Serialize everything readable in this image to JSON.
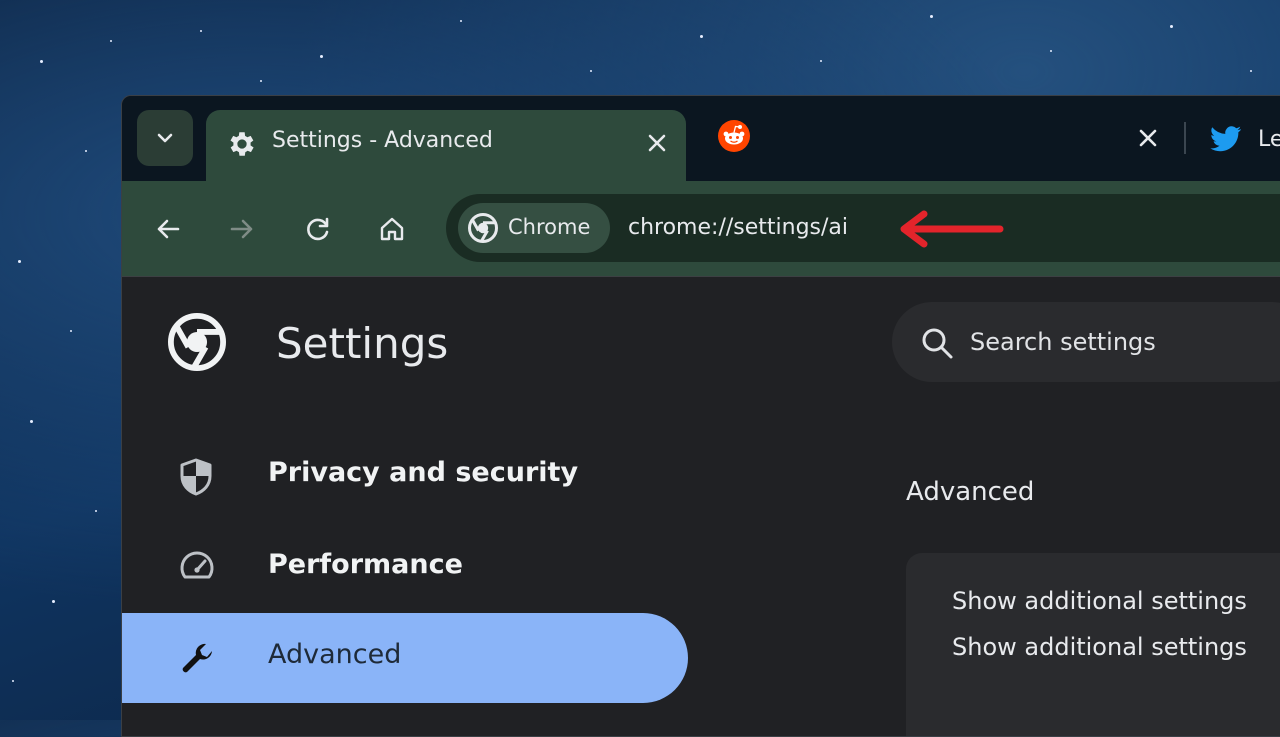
{
  "tabs": [
    {
      "title": "Settings - Advanced",
      "icon": "gear-icon",
      "active": true
    },
    {
      "title": "",
      "icon": "reddit-icon",
      "active": false
    },
    {
      "title": "Le",
      "icon": "twitter-icon",
      "active": false
    }
  ],
  "toolbar": {
    "chip_label": "Chrome",
    "url": "chrome://settings/ai"
  },
  "settings": {
    "title": "Settings",
    "search_placeholder": "Search settings",
    "nav": [
      {
        "label": "Privacy and security",
        "icon": "shield-icon"
      },
      {
        "label": "Performance",
        "icon": "speedometer-icon"
      },
      {
        "label": "Advanced",
        "icon": "wrench-icon",
        "selected": true
      }
    ],
    "section_title": "Advanced",
    "card_lines": [
      "Show additional settings",
      "Show additional settings"
    ]
  },
  "colors": {
    "accent": "#8ab4f8",
    "annotation_arrow": "#e3242b",
    "theme_green": "#2e4a3c"
  }
}
